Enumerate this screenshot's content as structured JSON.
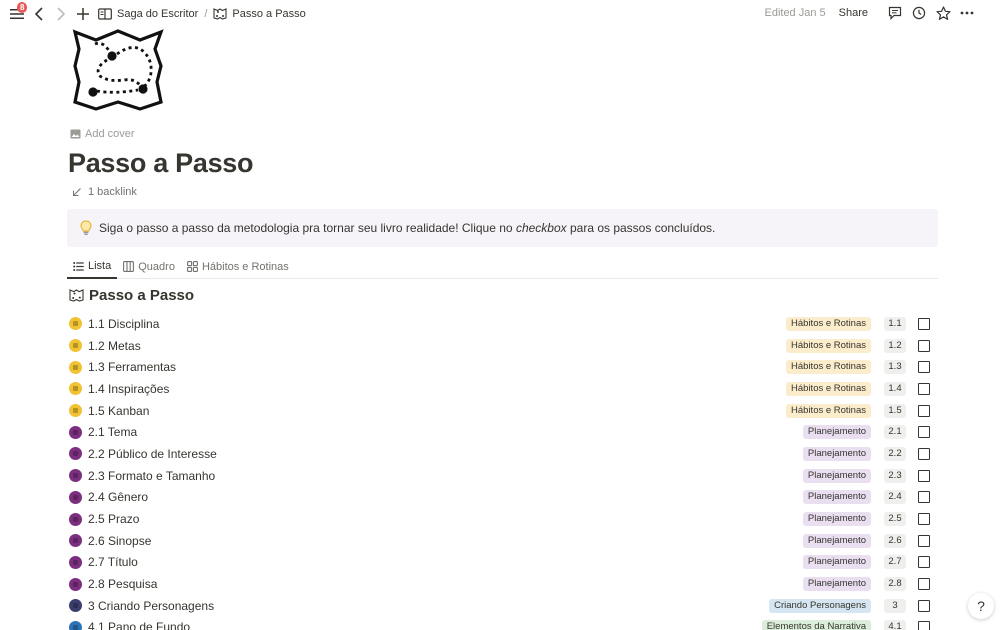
{
  "topbar": {
    "notification_count": "8",
    "breadcrumbs": [
      {
        "label": "Saga do Escritor",
        "icon": "book-icon"
      },
      {
        "label": "Passo a Passo",
        "icon": "map-icon"
      }
    ],
    "separator": "/",
    "edited": "Edited Jan 5",
    "share": "Share"
  },
  "page": {
    "add_cover": "Add cover",
    "title": "Passo a Passo",
    "backlink": "1 backlink"
  },
  "callout": {
    "text_before": "Siga o passo a passo da metodologia pra tornar seu livro realidade! Clique no ",
    "text_emph": "checkbox",
    "text_after": " para os passos concluídos."
  },
  "tabs": [
    {
      "label": "Lista",
      "active": true
    },
    {
      "label": "Quadro",
      "active": false
    },
    {
      "label": "Hábitos e Rotinas",
      "active": false
    }
  ],
  "section_title": "Passo a Passo",
  "rows": [
    {
      "name": "1.1 Disciplina",
      "tag": "Hábitos e Rotinas",
      "tag_type": "habitos",
      "num": "1.1",
      "dot": "#f1c232"
    },
    {
      "name": "1.2 Metas",
      "tag": "Hábitos e Rotinas",
      "tag_type": "habitos",
      "num": "1.2",
      "dot": "#f1c232"
    },
    {
      "name": "1.3 Ferramentas",
      "tag": "Hábitos e Rotinas",
      "tag_type": "habitos",
      "num": "1.3",
      "dot": "#f1c232"
    },
    {
      "name": "1.4 Inspirações",
      "tag": "Hábitos e Rotinas",
      "tag_type": "habitos",
      "num": "1.4",
      "dot": "#f1c232"
    },
    {
      "name": "1.5 Kanban",
      "tag": "Hábitos e Rotinas",
      "tag_type": "habitos",
      "num": "1.5",
      "dot": "#f1c232"
    },
    {
      "name": "2.1 Tema",
      "tag": "Planejamento",
      "tag_type": "plan",
      "num": "2.1",
      "dot": "#7b2f7e"
    },
    {
      "name": "2.2 Público de Interesse",
      "tag": "Planejamento",
      "tag_type": "plan",
      "num": "2.2",
      "dot": "#7b2f7e"
    },
    {
      "name": "2.3 Formato e Tamanho",
      "tag": "Planejamento",
      "tag_type": "plan",
      "num": "2.3",
      "dot": "#7b2f7e"
    },
    {
      "name": "2.4 Gênero",
      "tag": "Planejamento",
      "tag_type": "plan",
      "num": "2.4",
      "dot": "#7b2f7e"
    },
    {
      "name": "2.5 Prazo",
      "tag": "Planejamento",
      "tag_type": "plan",
      "num": "2.5",
      "dot": "#7b2f7e"
    },
    {
      "name": "2.6 Sinopse",
      "tag": "Planejamento",
      "tag_type": "plan",
      "num": "2.6",
      "dot": "#7b2f7e"
    },
    {
      "name": "2.7 Título",
      "tag": "Planejamento",
      "tag_type": "plan",
      "num": "2.7",
      "dot": "#7b2f7e"
    },
    {
      "name": "2.8 Pesquisa",
      "tag": "Planejamento",
      "tag_type": "plan",
      "num": "2.8",
      "dot": "#7b2f7e"
    },
    {
      "name": "3 Criando Personagens",
      "tag": "Criando Personagens",
      "tag_type": "pers",
      "num": "3",
      "dot": "#3c3f6e"
    },
    {
      "name": "4.1 Pano de Fundo",
      "tag": "Elementos da Narrativa",
      "tag_type": "elem",
      "num": "4.1",
      "dot": "#2e73b8"
    }
  ],
  "help": "?"
}
